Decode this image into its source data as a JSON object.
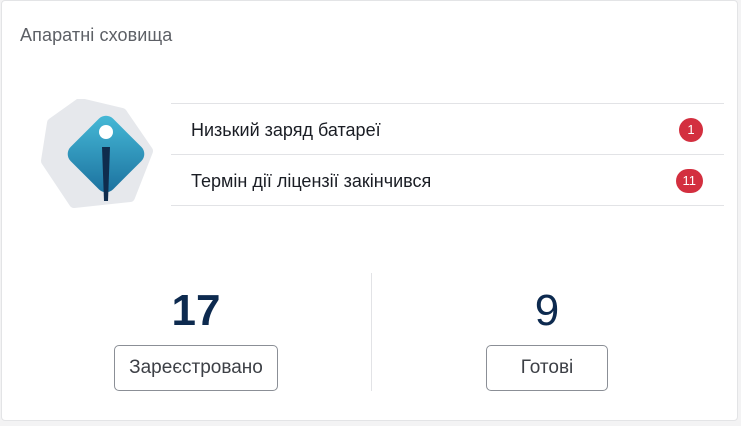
{
  "card": {
    "title": "Апаратні сховища"
  },
  "illustration": {
    "icon": "info-icon",
    "colors": {
      "backdrop": "#e6e8ec",
      "gem_light": "#3fb0d0",
      "gem_dark": "#1a6e9c",
      "dot": "#ffffff",
      "bar": "#0f2c4d"
    }
  },
  "alerts": [
    {
      "label": "Низький заряд батареї",
      "count": "1"
    },
    {
      "label": "Термін дії ліцензії закінчився",
      "count": "11"
    }
  ],
  "alert_badge_color": "#d32f3f",
  "stats": {
    "registered": {
      "value": "17",
      "label": "Зареєстровано"
    },
    "ready": {
      "value": "9",
      "label": "Готові"
    }
  }
}
